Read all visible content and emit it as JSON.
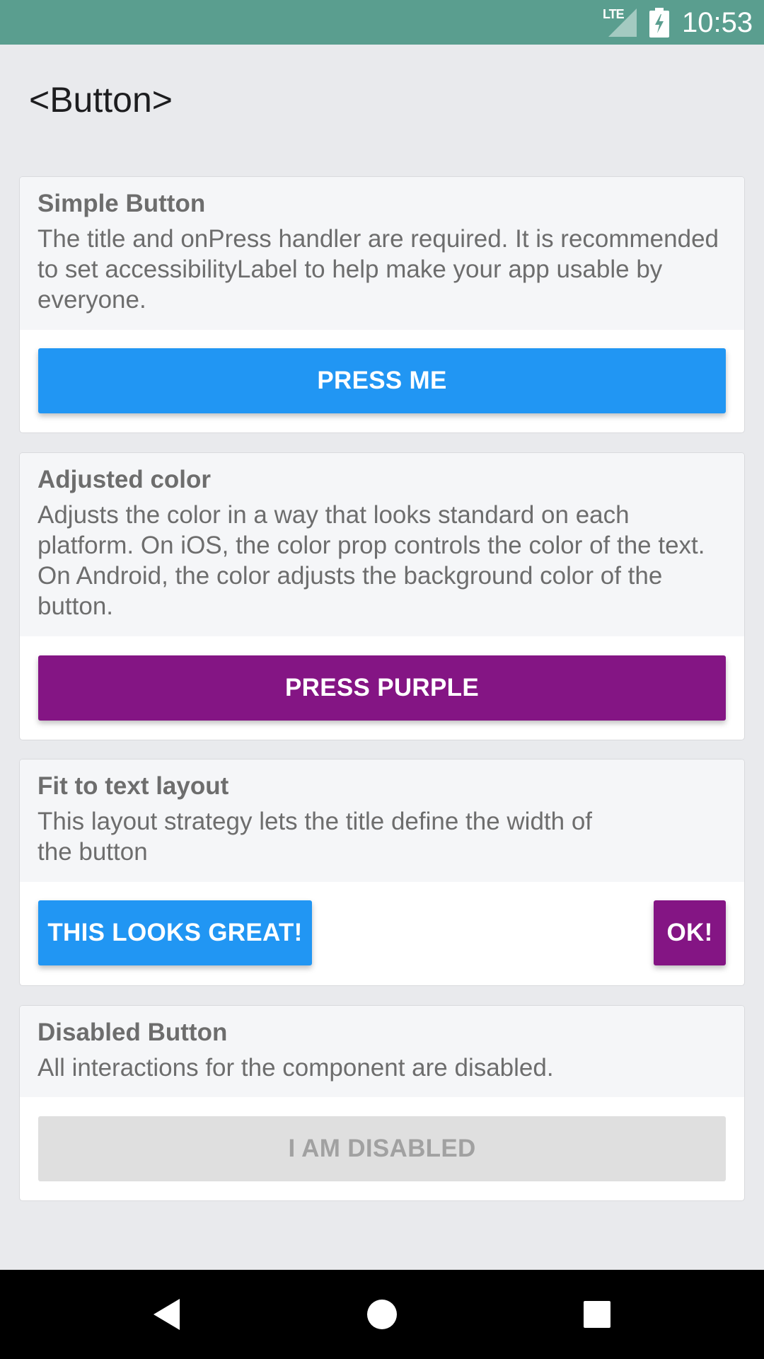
{
  "status_bar": {
    "network": "LTE",
    "time": "10:53"
  },
  "app_bar": {
    "title": "<Button>"
  },
  "cards": [
    {
      "title": "Simple Button",
      "description": "The title and onPress handler are required. It is recommended to set accessibilityLabel to help make your app usable by everyone.",
      "buttons": [
        {
          "label": "PRESS ME",
          "color": "#2196f3"
        }
      ]
    },
    {
      "title": "Adjusted color",
      "description": "Adjusts the color in a way that looks standard on each platform. On iOS, the color prop controls the color of the text. On Android, the color adjusts the background color of the button.",
      "buttons": [
        {
          "label": "PRESS PURPLE",
          "color": "#841584"
        }
      ]
    },
    {
      "title": "Fit to text layout",
      "description": "This layout strategy lets the title define the width of the button",
      "buttons": [
        {
          "label": "THIS LOOKS GREAT!",
          "color": "#2196f3"
        },
        {
          "label": "OK!",
          "color": "#841584"
        }
      ]
    },
    {
      "title": "Disabled Button",
      "description": "All interactions for the component are disabled.",
      "buttons": [
        {
          "label": "I AM DISABLED",
          "color": "#dfdfdf",
          "disabled": true
        }
      ]
    }
  ],
  "nav_bar": {
    "icons": [
      "back-icon",
      "home-icon",
      "recents-icon"
    ]
  }
}
